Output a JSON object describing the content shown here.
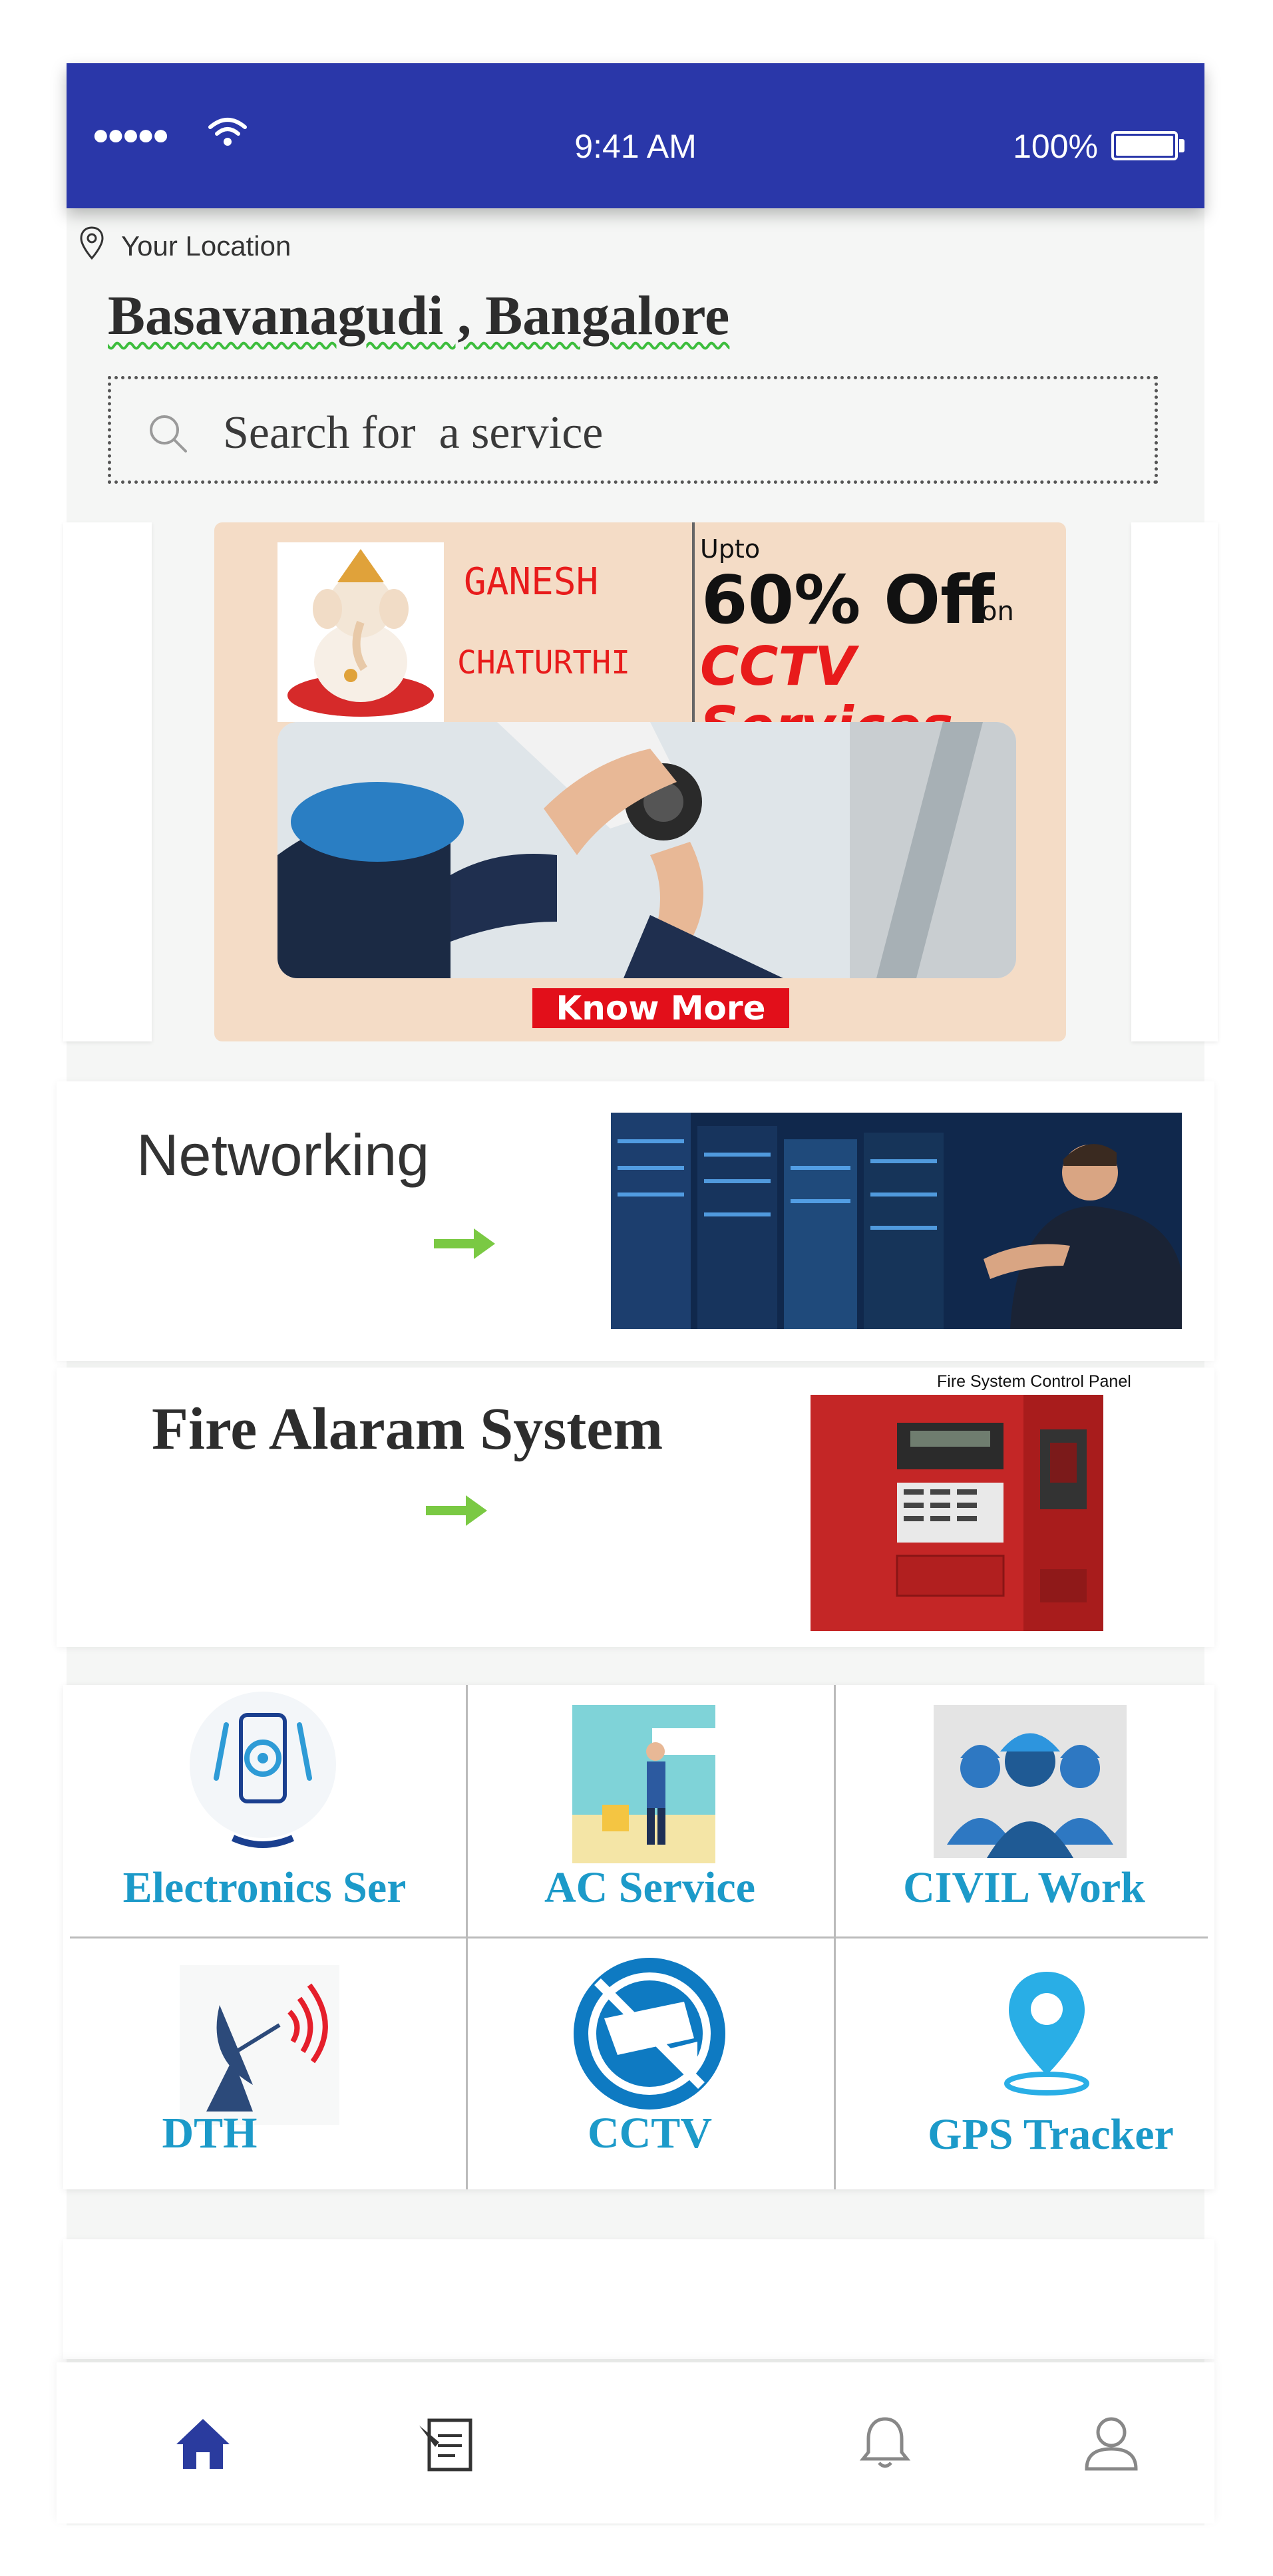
{
  "status_bar": {
    "signal": "●●●●●",
    "time": "9:41 AM",
    "battery": "100%"
  },
  "location": {
    "label": "Your Location",
    "city": "Basavanagudi , Bangalore"
  },
  "search": {
    "placeholder": "Search for  a service"
  },
  "banner": {
    "festival_line1": "GANESH",
    "festival_line2": "CHATURTHI",
    "upto": "Upto",
    "discount": "60% Off",
    "on": "on",
    "service": "CCTV Services",
    "cta": "Know More"
  },
  "featured": [
    {
      "title": "Networking"
    },
    {
      "title": "Fire Alaram System",
      "image_caption": "Fire System Control Panel"
    }
  ],
  "services": [
    {
      "label": "Electronics Ser",
      "icon": "phone-settings-icon"
    },
    {
      "label": "AC Service",
      "icon": "ac-technician-icon"
    },
    {
      "label": "CIVIL Work",
      "icon": "workers-icon"
    },
    {
      "label": "DTH",
      "icon": "satellite-dish-icon"
    },
    {
      "label": "CCTV",
      "icon": "cctv-camera-icon"
    },
    {
      "label": "GPS Tracker",
      "icon": "location-pin-icon"
    }
  ],
  "colors": {
    "primary": "#2a37a9",
    "service_text": "#1c9ac9",
    "promo_red": "#e20f1a",
    "arrow_green": "#7ac943"
  },
  "bottom_nav": [
    {
      "name": "home",
      "icon": "home-icon",
      "active": true
    },
    {
      "name": "bookings",
      "icon": "bookings-icon",
      "active": false
    },
    {
      "name": "notifications",
      "icon": "bell-icon",
      "active": false
    },
    {
      "name": "profile",
      "icon": "profile-icon",
      "active": false
    }
  ]
}
